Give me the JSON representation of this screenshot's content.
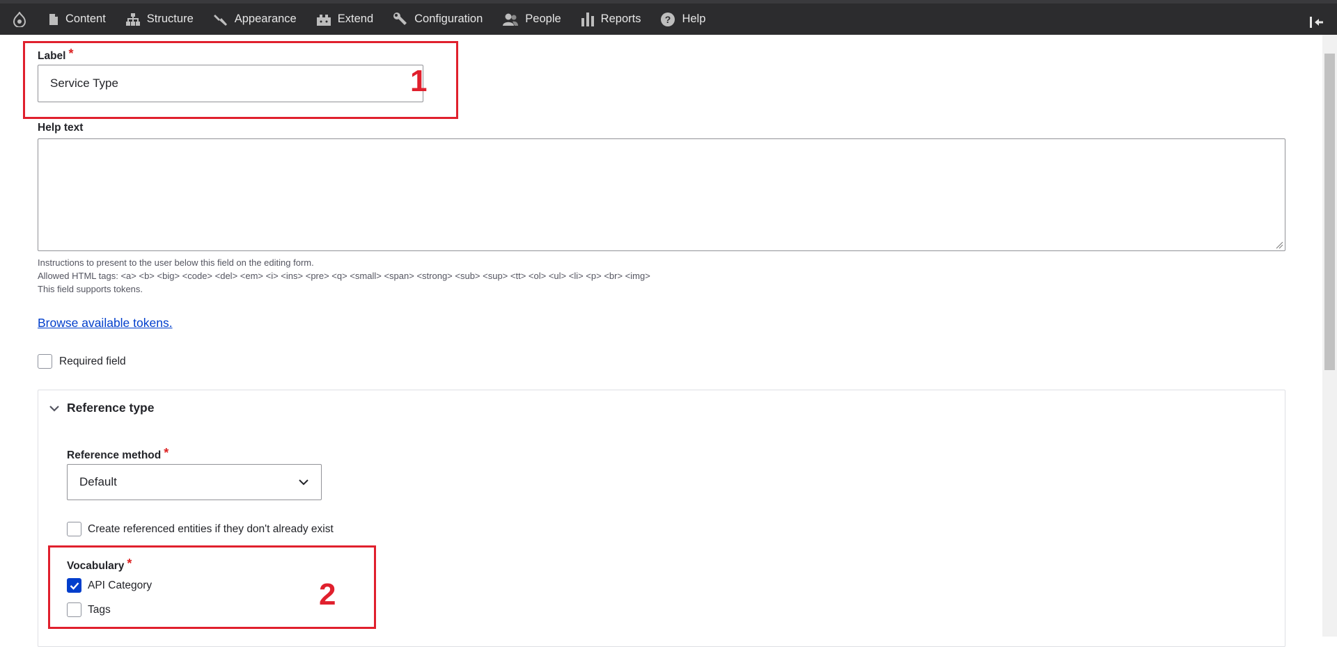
{
  "toolbar": {
    "home_icon": "drupal-drop-icon",
    "items": [
      {
        "label": "Content",
        "icon": "document-icon"
      },
      {
        "label": "Structure",
        "icon": "sitemap-icon"
      },
      {
        "label": "Appearance",
        "icon": "paintbrush-icon"
      },
      {
        "label": "Extend",
        "icon": "puzzle-icon"
      },
      {
        "label": "Configuration",
        "icon": "wrench-icon"
      },
      {
        "label": "People",
        "icon": "people-icon"
      },
      {
        "label": "Reports",
        "icon": "bar-chart-icon"
      },
      {
        "label": "Help",
        "icon": "help-icon"
      }
    ],
    "collapse_icon": "collapse-toolbar-icon",
    "background": "#2c2c2e"
  },
  "form": {
    "label_field": {
      "label": "Label",
      "value": "Service Type"
    },
    "help_text": {
      "label": "Help text",
      "value": "",
      "description_lines": [
        "Instructions to present to the user below this field on the editing form.",
        "Allowed HTML tags: <a> <b> <big> <code> <del> <em> <i> <ins> <pre> <q> <small> <span> <strong> <sub> <sup> <tt> <ol> <ul> <li> <p> <br> <img>",
        "This field supports tokens."
      ]
    },
    "browse_tokens_link": "Browse available tokens.",
    "required_field": {
      "label": "Required field",
      "checked": false
    },
    "reference_type": {
      "summary": "Reference type",
      "expanded": true,
      "reference_method": {
        "label": "Reference method",
        "selected": "Default"
      },
      "create_referenced": {
        "label": "Create referenced entities if they don't already exist",
        "checked": false
      },
      "vocabulary": {
        "label": "Vocabulary",
        "options": [
          {
            "label": "API Category",
            "checked": true
          },
          {
            "label": "Tags",
            "checked": false
          }
        ]
      }
    }
  },
  "annotations": [
    {
      "number": "1"
    },
    {
      "number": "2"
    }
  ],
  "colors": {
    "accent": "#003ecc",
    "required_star": "#dc2323",
    "annotation": "#e0202d"
  }
}
